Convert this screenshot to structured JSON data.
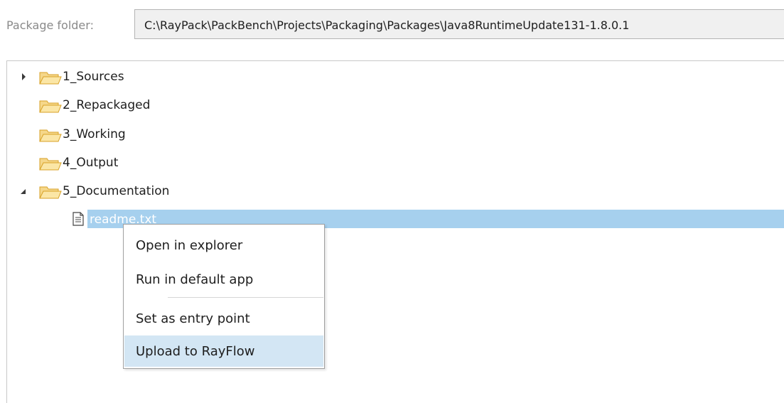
{
  "package": {
    "label": "Package folder:",
    "path": "C:\\RayPack\\PackBench\\Projects\\Packaging\\Packages\\Java8RuntimeUpdate131-1.8.0.1"
  },
  "tree": {
    "items": [
      {
        "label": "1_Sources",
        "icon": "folder-open-icon",
        "state": "collapsed"
      },
      {
        "label": "2_Repackaged",
        "icon": "folder-open-icon",
        "state": "leaf"
      },
      {
        "label": "3_Working",
        "icon": "folder-open-icon",
        "state": "leaf"
      },
      {
        "label": "4_Output",
        "icon": "folder-open-icon",
        "state": "leaf"
      },
      {
        "label": "5_Documentation",
        "icon": "folder-open-icon",
        "state": "expanded"
      },
      {
        "label": "readme.txt",
        "icon": "text-file-icon",
        "state": "selected"
      }
    ]
  },
  "context_menu": {
    "items": [
      {
        "label": "Open in explorer"
      },
      {
        "label": "Run in default app"
      },
      {
        "label": "Set as entry point"
      },
      {
        "label": "Upload to RayFlow",
        "highlighted": true
      }
    ]
  },
  "colors": {
    "selection": "#a6d0ee",
    "menu_hover": "#d3e6f4",
    "folder_fill": "#f5d78a",
    "folder_stroke": "#d8a227"
  }
}
